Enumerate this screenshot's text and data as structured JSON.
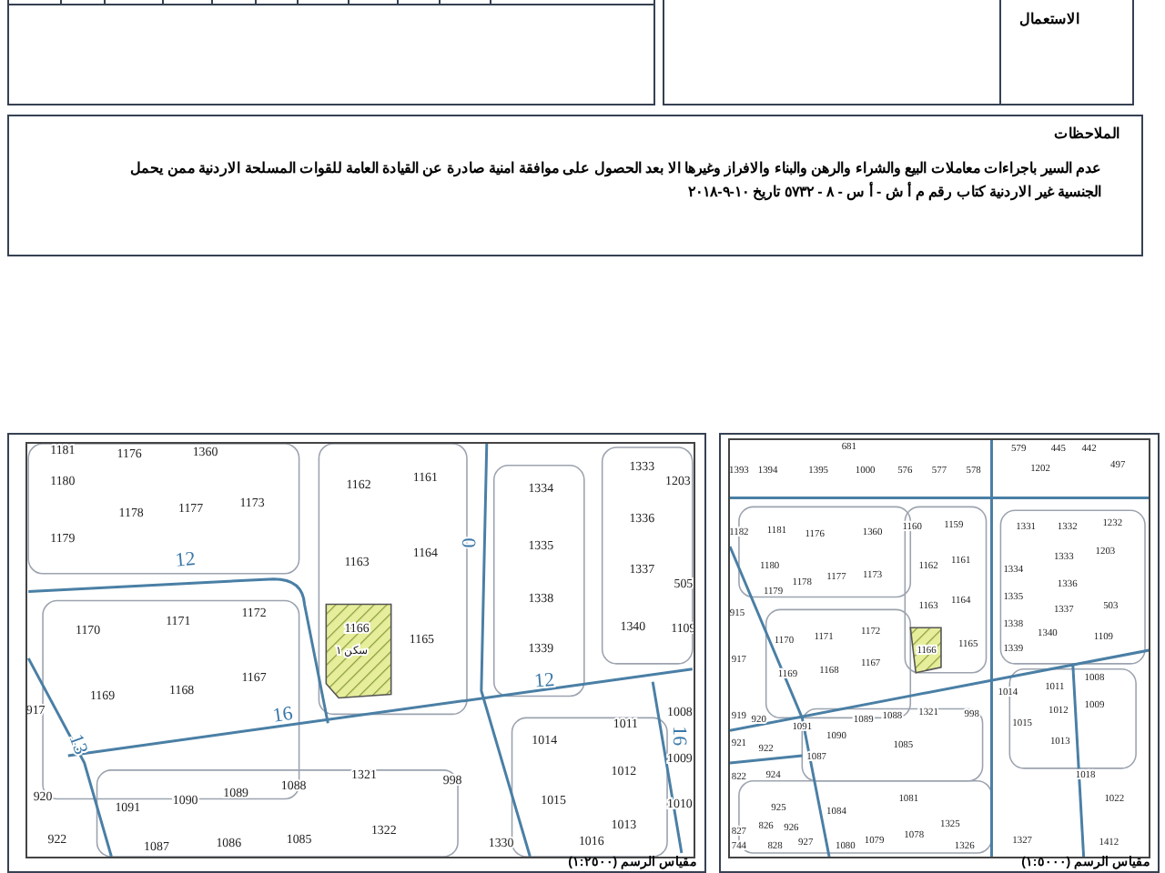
{
  "usage_header": {
    "label": "الاستعمال"
  },
  "notes": {
    "title": "الملاحظات",
    "text": "عدم السير باجراءات معاملات البيع والشراء والرهن والبناء والافراز وغيرها الا بعد الحصول على موافقة امنية صادرة عن القيادة العامة للقوات المسلحة الاردنية ممن يحمل الجنسية غير الاردنية كتاب رقم م أ ش - أ س - ٨ - ٥٧٣٢ تاريخ ١٠-٩-٢٠١٨"
  },
  "maps": [
    {
      "parcels": [
        "681",
        "579",
        "445",
        "442",
        "1393",
        "1394",
        "1395",
        "1000",
        "576",
        "577",
        "578",
        "1202",
        "497",
        "1182",
        "1181",
        "1176",
        "1360",
        "1160",
        "1159",
        "1331",
        "1332",
        "1232",
        "1180",
        "1162",
        "1161",
        "1333",
        "1203",
        "1334",
        "1178",
        "1177",
        "1173",
        "1336",
        "1179",
        "1335",
        "1163",
        "1164",
        "1337",
        "503",
        "915",
        "1338",
        "1170",
        "1171",
        "1172",
        "1165",
        "1340",
        "1109",
        "1339",
        "917",
        "1169",
        "1168",
        "1167",
        "1008",
        "1011",
        "1014",
        "1009",
        "919",
        "920",
        "1089",
        "1088",
        "1321",
        "998",
        "1012",
        "1091",
        "1090",
        "1015",
        "921",
        "922",
        "1085",
        "1013",
        "1087",
        "822",
        "924",
        "1018",
        "925",
        "1084",
        "1081",
        "1022",
        "827",
        "826",
        "926",
        "1325",
        "744",
        "828",
        "927",
        "1080",
        "1079",
        "1078",
        "1326",
        "1327",
        "1412"
      ],
      "plot": {
        "number": "1166"
      },
      "scale": "مقياس الرسم (١:٥٠٠٠)"
    },
    {
      "parcels": [
        "1181",
        "1176",
        "1360",
        "1180",
        "1178",
        "1177",
        "1173",
        "1179",
        "1162",
        "1161",
        "1163",
        "1164",
        "1334",
        "1333",
        "1203",
        "1336",
        "1335",
        "1337",
        "1338",
        "505",
        "1340",
        "1109",
        "1339",
        "1170",
        "1171",
        "1172",
        "1165",
        "1169",
        "1168",
        "1167",
        "917",
        "1008",
        "1011",
        "1014",
        "1009",
        "1012",
        "1321",
        "998",
        "920",
        "1088",
        "1089",
        "1090",
        "1091",
        "1015",
        "1010",
        "1013",
        "922",
        "1087",
        "1086",
        "1085",
        "1322",
        "1330",
        "1016"
      ],
      "roads": [
        "12",
        "0",
        "12",
        "16",
        "13",
        "16"
      ],
      "plot": {
        "number": "1166",
        "zoning": "سكن ١"
      },
      "scale": "مقياس الرسم (١:٢٥٠٠)"
    }
  ]
}
